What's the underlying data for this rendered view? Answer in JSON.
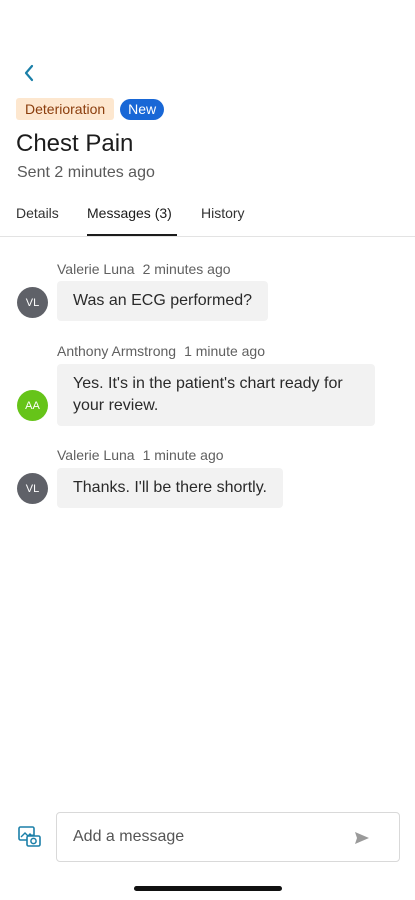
{
  "header": {
    "back_icon": "chevron-left-icon",
    "badges": {
      "category": "Deterioration",
      "status": "New"
    },
    "title": "Chest Pain",
    "sent": "Sent 2 minutes ago"
  },
  "tabs": [
    {
      "label": "Details",
      "active": false
    },
    {
      "label": "Messages (3)",
      "active": true
    },
    {
      "label": "History",
      "active": false
    }
  ],
  "messages": [
    {
      "sender": "Valerie Luna",
      "time": "2 minutes ago",
      "initials": "VL",
      "avatar_color": "#5f6168",
      "text": "Was an ECG performed?"
    },
    {
      "sender": "Anthony Armstrong",
      "time": "1 minute ago",
      "initials": "AA",
      "avatar_color": "#66c419",
      "text_line1": "Yes. It's in the patient's chart ready for",
      "text_line2": "your review."
    },
    {
      "sender": "Valerie Luna",
      "time": "1 minute ago",
      "initials": "VL",
      "avatar_color": "#5f6168",
      "text": "Thanks. I'll be there shortly."
    }
  ],
  "composer": {
    "placeholder": "Add a message",
    "attach_icon": "camera-icon",
    "send_icon": "send-icon"
  },
  "colors": {
    "accent": "#1867d6",
    "badge_bg": "#fde7cf",
    "badge_text": "#8a3d0c",
    "back_icon": "#1a7fa8"
  }
}
